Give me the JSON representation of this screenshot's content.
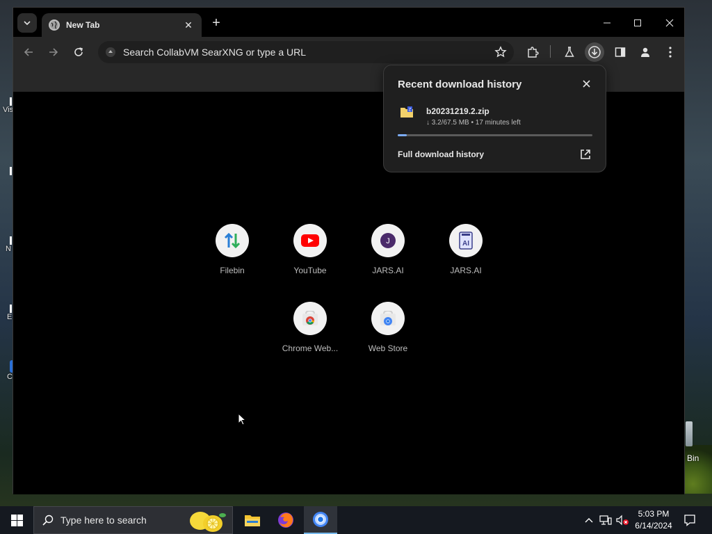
{
  "browser": {
    "tab": {
      "title": "New Tab"
    },
    "omnibox": {
      "placeholder": "Search CollabVM SearXNG or type a URL"
    }
  },
  "shortcuts": [
    {
      "label": "Filebin",
      "icon": "updown-arrows-icon"
    },
    {
      "label": "YouTube",
      "icon": "youtube-icon"
    },
    {
      "label": "JARS.AI",
      "icon": "jars-j-icon"
    },
    {
      "label": "JARS.AI",
      "icon": "jars-ai-icon"
    },
    {
      "label": "Chrome Web...",
      "icon": "chrome-web-store-icon"
    },
    {
      "label": "Web Store",
      "icon": "web-store-icon"
    }
  ],
  "download_bubble": {
    "title": "Recent download history",
    "file": {
      "name": "b20231219.2.zip",
      "status": "↓ 3.2/67.5 MB • 17 minutes left",
      "progress_fraction": 0.047
    },
    "full_history_label": "Full download history"
  },
  "desktop": {
    "fragments": [
      "Vis",
      "N",
      "E",
      "C"
    ],
    "recycle_bin_label": "Bin"
  },
  "taskbar": {
    "search_placeholder": "Type here to search",
    "clock_time": "5:03 PM",
    "clock_date": "6/14/2024"
  },
  "colors": {
    "accent_blue": "#7cacf8",
    "youtube_red": "#ff0000",
    "jars_purple": "#4a2a6a"
  }
}
